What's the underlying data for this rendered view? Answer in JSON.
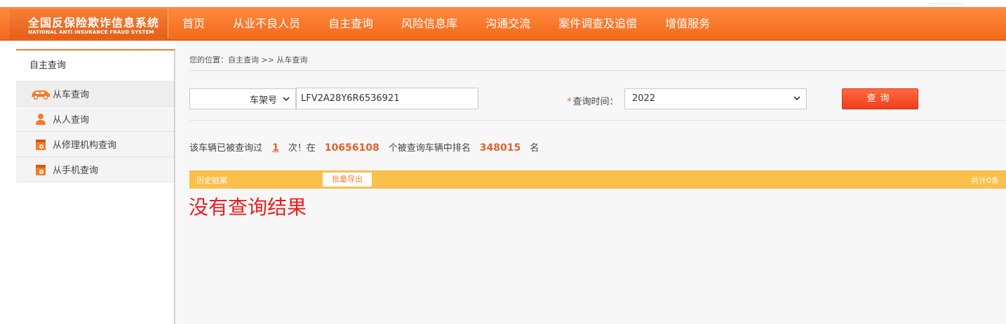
{
  "header": {
    "logo_cn": "全国反保险欺诈信息系统",
    "logo_en": "NATIONAL ANTI INSURANCE FRAUD SYSTEM",
    "nav": [
      "首页",
      "从业不良人员",
      "自主查询",
      "风险信息库",
      "沟通交流",
      "案件调查及追偿",
      "增值服务"
    ]
  },
  "sidebar": {
    "title": "自主查询",
    "items": [
      {
        "label": "从车查询",
        "icon": "car-icon"
      },
      {
        "label": "从人查询",
        "icon": "person-icon"
      },
      {
        "label": "从修理机构查询",
        "icon": "repair-shop-icon"
      },
      {
        "label": "从手机查询",
        "icon": "phone-icon"
      }
    ]
  },
  "breadcrumb": "您的位置：自主查询 >> 从车查询",
  "form": {
    "type_value": "车架号",
    "vin_value": "LFV2A28Y6R6536921",
    "time_label": "查询时间：",
    "time_star": "*",
    "time_value": "2022",
    "query_button": "查询"
  },
  "stats": {
    "prefix": "该车辆已被查询过",
    "count": "1",
    "mid1": "次！在",
    "total": "10656108",
    "mid2": "个被查询车辆中排名",
    "rank": "348015",
    "suffix": "名"
  },
  "results_bar": {
    "label": "历史赔案",
    "export_button": "批量导出",
    "total": "共计0条"
  },
  "no_result": "没有查询结果",
  "colors": {
    "nav_orange": "#f26a1b",
    "bar_yellow": "#fbbf4b",
    "error_red": "#ee1b1b",
    "button_red": "#ee3e1c"
  }
}
